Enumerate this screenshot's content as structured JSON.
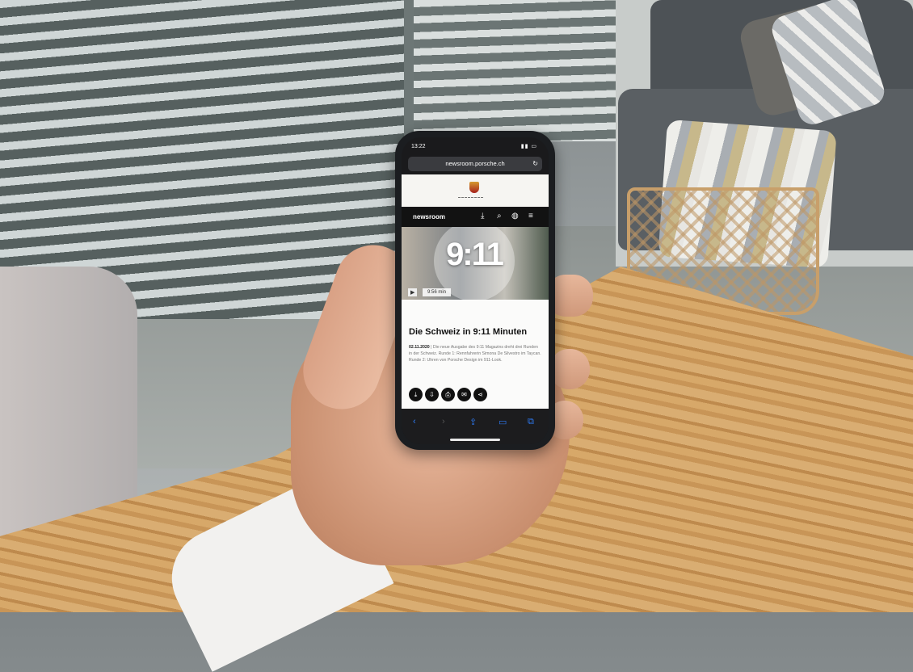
{
  "status_bar": {
    "time": "13:22",
    "signal": "▪▪▪"
  },
  "browser": {
    "url": "newsroom.porsche.ch",
    "reload_icon": "reload-icon"
  },
  "site": {
    "logo_text": "PORSCHE",
    "nav_title": "newsroom",
    "nav_icons": [
      "download-icon",
      "search-icon",
      "globe-icon",
      "menu-icon"
    ]
  },
  "video": {
    "overlay_text": "9:11",
    "duration": "9:56 min",
    "play_icon": "play-icon"
  },
  "article": {
    "headline": "Die Schweiz in 9:11 Minuten",
    "date": "02.11.2020",
    "summary": "Die neue Ausgabe des 9:11 Magazins dreht drei Runden in der Schweiz. Runde 1: Rennfahrerin Simona De Silvestro im Taycan. Runde 2: Uhren von Porsche Design im 911-Look.",
    "share_icons": [
      "download-icon",
      "download-alt-icon",
      "print-icon",
      "mail-icon",
      "share-icon"
    ]
  },
  "safari_toolbar": {
    "icons": [
      "back-icon",
      "forward-icon",
      "share-icon",
      "bookmarks-icon",
      "tabs-icon"
    ]
  }
}
